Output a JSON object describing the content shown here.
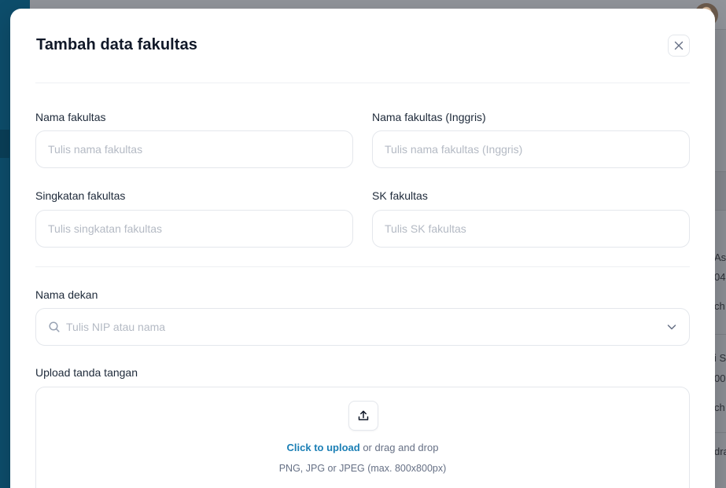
{
  "background": {
    "row_text_1": "As",
    "row_text_2": "04",
    "row_text_3": "ch",
    "row_text_4": "i S",
    "row_text_5": "00",
    "row_text_6": "ch",
    "row_text_7": "dra"
  },
  "modal": {
    "title": "Tambah data fakultas",
    "fields": {
      "nama_fakultas": {
        "label": "Nama fakultas",
        "placeholder": "Tulis nama fakultas",
        "value": ""
      },
      "nama_fakultas_inggris": {
        "label": "Nama fakultas (Inggris)",
        "placeholder": "Tulis nama fakultas (Inggris)",
        "value": ""
      },
      "singkatan_fakultas": {
        "label": "Singkatan fakultas",
        "placeholder": "Tulis singkatan fakultas",
        "value": ""
      },
      "sk_fakultas": {
        "label": "SK fakultas",
        "placeholder": "Tulis SK fakultas",
        "value": ""
      },
      "nama_dekan": {
        "label": "Nama dekan",
        "placeholder": "Tulis NIP atau nama"
      },
      "upload_tanda_tangan": {
        "label": "Upload tanda tangan",
        "link_text": "Click to upload",
        "rest_text": "or drag and drop",
        "hint": "PNG, JPG or JPEG (max. 800x800px)"
      }
    }
  },
  "colors": {
    "primary_link": "#1b7fb5",
    "sidebar": "#0d4d6b",
    "overlay": "#8b8e94"
  },
  "icons": {
    "close": "close-icon",
    "search": "search-icon",
    "chevron": "chevron-down-icon",
    "upload": "upload-icon"
  }
}
